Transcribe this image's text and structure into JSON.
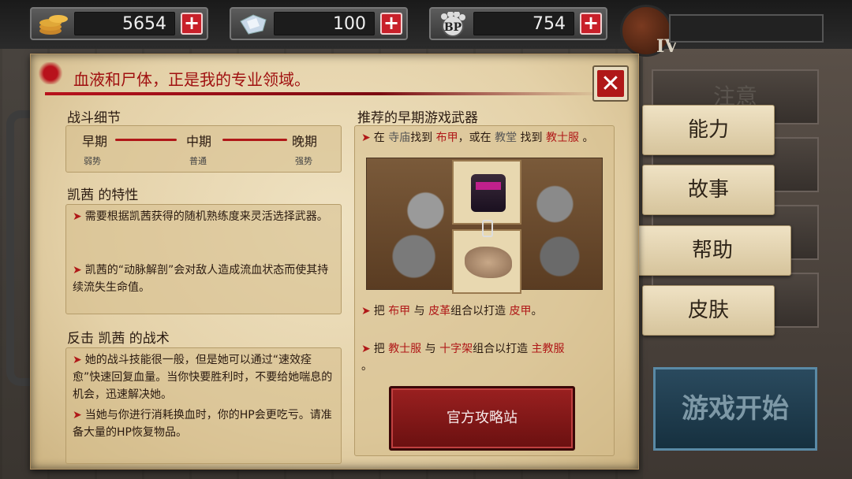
{
  "resources": [
    {
      "icon": "coins-icon",
      "value": "5654"
    },
    {
      "icon": "diamond-icon",
      "value": "100"
    },
    {
      "icon": "bp-paw-icon",
      "value": "754"
    }
  ],
  "player": {
    "rank": "IV",
    "name": ""
  },
  "panel": {
    "quote": "血液和尸体，正是我的专业领域。",
    "combat_title": "战斗细节",
    "stages": [
      {
        "label": "早期",
        "sub": "弱势"
      },
      {
        "label": "中期",
        "sub": "普通"
      },
      {
        "label": "晚期",
        "sub": "强势"
      }
    ],
    "traits_title": "凯茜 的特性",
    "traits": [
      "需要根据凯茜获得的随机熟练度来灵活选择武器。",
      "凯茜的“动脉解剖”会对敌人造成流血状态而使其持续流失生命值。"
    ],
    "counter_title": "反击 凯茜 的战术",
    "counters": [
      "她的战斗技能很一般，但是她可以通过“速效痊愈”快速回复血量。当你快要胜利时，不要给她喘息的机会，迅速解决她。",
      "当她与你进行消耗换血时，你的HP会更吃亏。请准备大量的HP恢复物品。"
    ],
    "weapons_title": "推荐的早期游戏武器",
    "tip1": {
      "a": "在",
      "b": "寺庙",
      "c": "找到",
      "d": "布甲",
      "e": "，或在",
      "f": "教堂",
      "g": "找到",
      "h": "教士服",
      "i": "。"
    },
    "tip2": {
      "a": "把",
      "b": "布甲",
      "c": "与",
      "d": "皮革",
      "e": "组合以打造",
      "f": "皮甲",
      "g": "。"
    },
    "tip3": {
      "a": "把",
      "b": "教士服",
      "c": "与",
      "d": "十字架",
      "e": "组合以打造",
      "f": "主教服",
      "g": "。"
    },
    "guide_button": "官方攻略站"
  },
  "menu": {
    "notice": "注意",
    "tabs": [
      "能力",
      "故事",
      "帮助",
      "皮肤"
    ],
    "active_tab": "帮助",
    "start": "游戏开始"
  },
  "colors": {
    "accent_red": "#b01818",
    "parchment": "#e8d6ae"
  }
}
